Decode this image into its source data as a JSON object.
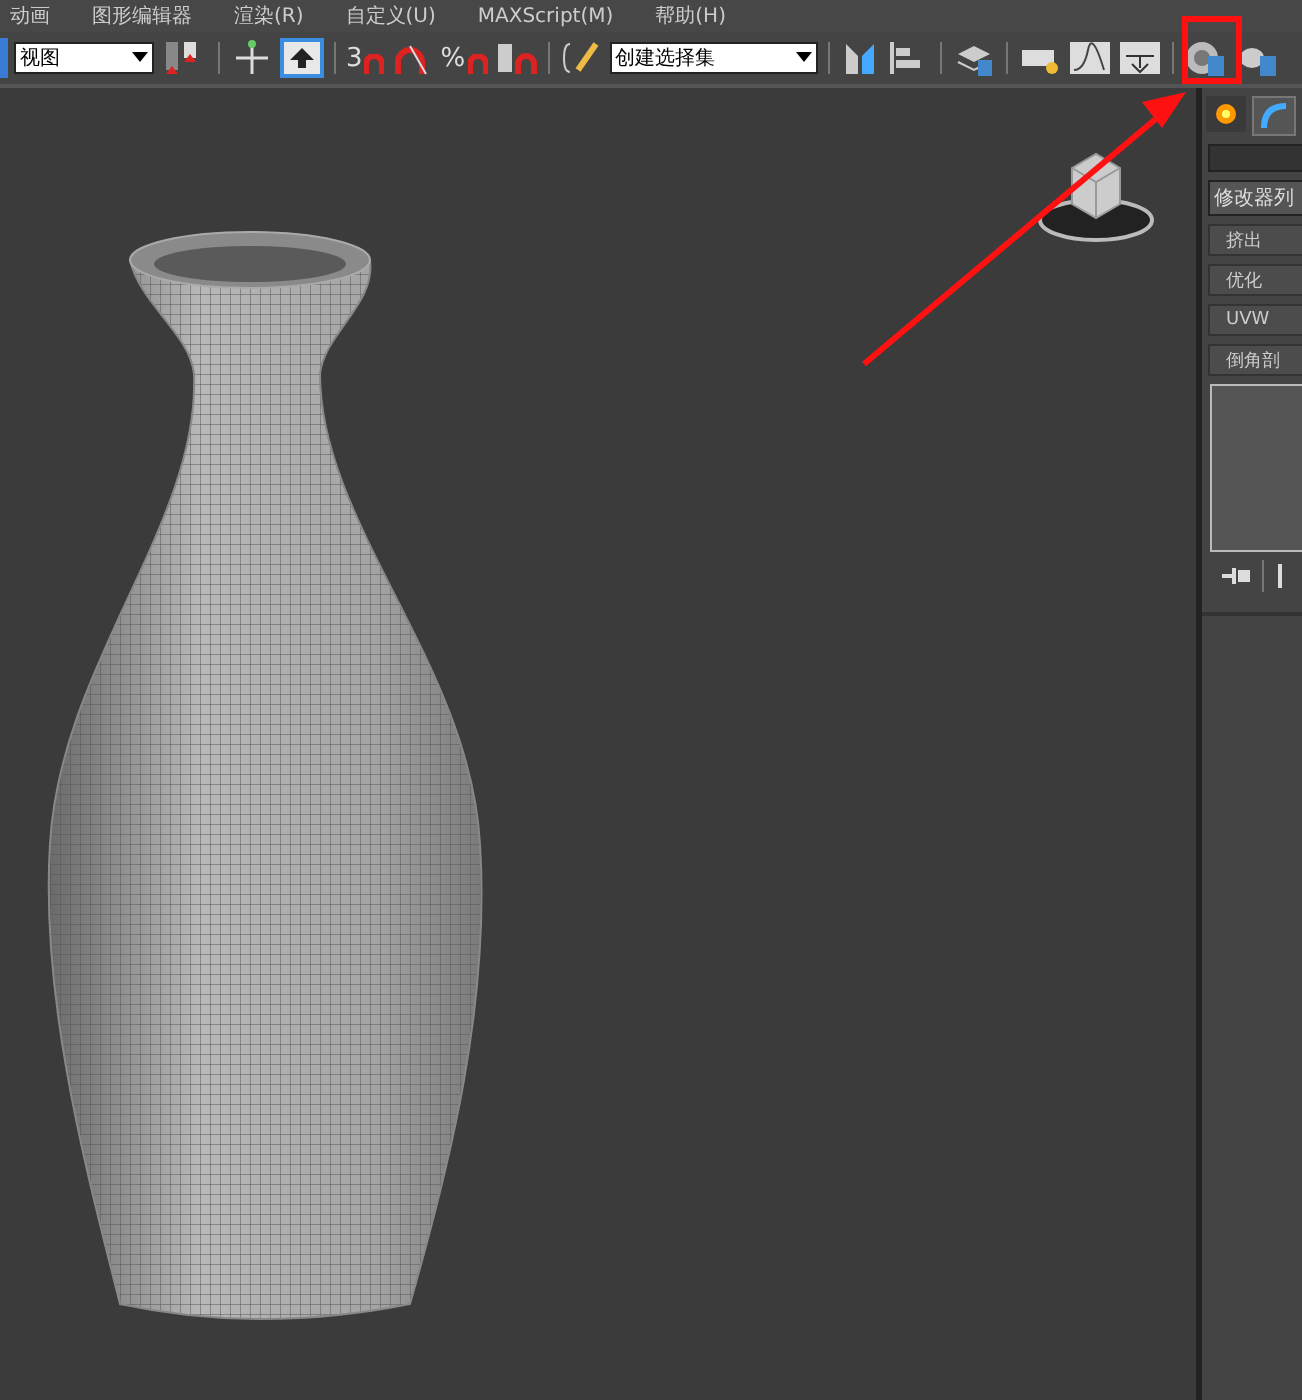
{
  "menu": [
    "动画",
    "图形编辑器",
    "渲染(R)",
    "自定义(U)",
    "MAXScript(M)",
    "帮助(H)"
  ],
  "toolbar": {
    "view_dropdown": "视图",
    "move_tool_active": true,
    "snap_labels": [
      "3",
      "%"
    ],
    "selection_set": "创建选择集"
  },
  "command_panel": {
    "tabs": [
      {
        "selected": false
      },
      {
        "selected": true
      }
    ],
    "modifier_list": "修改器列",
    "buttons": [
      "挤出",
      "优化",
      "UVW",
      "倒角剖"
    ]
  }
}
